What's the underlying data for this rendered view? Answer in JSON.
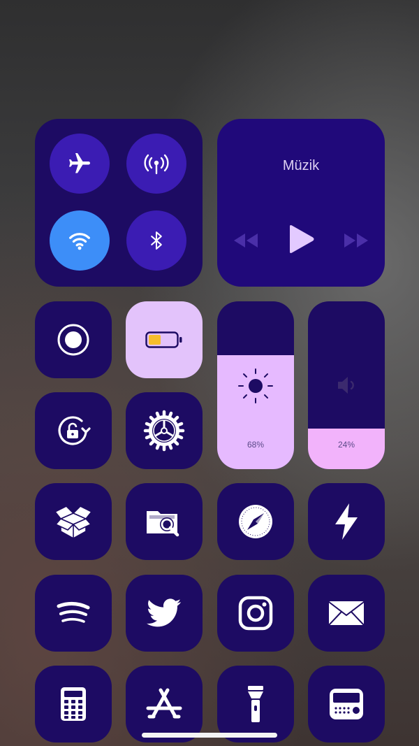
{
  "connectivity": {
    "airplane_mode": {
      "icon": "airplane-icon",
      "active": false
    },
    "cellular_data": {
      "icon": "antenna-icon",
      "active": false
    },
    "wifi": {
      "icon": "wifi-icon",
      "active": true
    },
    "bluetooth": {
      "icon": "bluetooth-icon",
      "active": false
    }
  },
  "music": {
    "title": "Müzik",
    "controls": [
      "rewind-icon",
      "play-icon",
      "fast-forward-icon"
    ]
  },
  "brightness": {
    "percent_label": "68%",
    "level": 0.68
  },
  "volume": {
    "percent_label": "24%",
    "level": 0.24
  },
  "toggles": [
    {
      "name": "screen-record",
      "icon": "record-icon"
    },
    {
      "name": "low-power-mode",
      "icon": "battery-icon"
    },
    {
      "name": "orientation-lock",
      "icon": "rotation-lock-icon"
    },
    {
      "name": "settings",
      "icon": "gear-icon"
    }
  ],
  "app_shortcuts": [
    {
      "name": "cydia",
      "icon": "box-icon"
    },
    {
      "name": "filza",
      "icon": "folder-search-icon"
    },
    {
      "name": "safari",
      "icon": "compass-icon"
    },
    {
      "name": "flash",
      "icon": "lightning-icon"
    },
    {
      "name": "spotify",
      "icon": "spotify-icon"
    },
    {
      "name": "twitter",
      "icon": "twitter-bird-icon"
    },
    {
      "name": "instagram",
      "icon": "instagram-icon"
    },
    {
      "name": "mail",
      "icon": "envelope-icon"
    },
    {
      "name": "calculator",
      "icon": "calculator-icon"
    },
    {
      "name": "app-store",
      "icon": "app-store-icon"
    },
    {
      "name": "flashlight",
      "icon": "flashlight-icon"
    },
    {
      "name": "radio",
      "icon": "radio-icon"
    }
  ],
  "colors": {
    "tile": "#1d0b63",
    "circle": "#3b1cb3",
    "wifi_active": "#3d8ef8",
    "low_power_tile": "#e3c3fb",
    "battery_fill": "#f7bd2c",
    "brightness_fill": "#e6baff",
    "volume_fill": "#f2b3fb"
  }
}
